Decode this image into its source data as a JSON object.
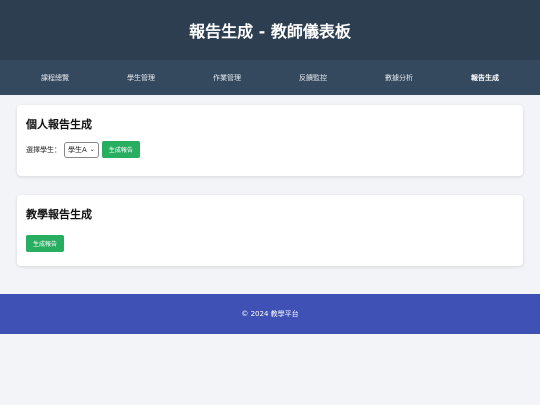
{
  "header": {
    "title": "報告生成 - 教師儀表板"
  },
  "nav": {
    "items": [
      {
        "label": "課程總覽"
      },
      {
        "label": "學生管理"
      },
      {
        "label": "作業管理"
      },
      {
        "label": "反饋監控"
      },
      {
        "label": "數據分析"
      },
      {
        "label": "報告生成"
      }
    ],
    "active_index": 5
  },
  "individual_report": {
    "title": "個人報告生成",
    "select_label": "選擇學生：",
    "selected_student": "學生A",
    "button_label": "生成報告"
  },
  "teaching_report": {
    "title": "教學報告生成",
    "button_label": "生成報告"
  },
  "footer": {
    "text": "© 2024 教學平台"
  },
  "colors": {
    "header_bg": "#2c3e50",
    "nav_bg": "#34495e",
    "button_green": "#27ae60",
    "footer_bg": "#3f51b5",
    "page_bg": "#f3f4f8"
  }
}
